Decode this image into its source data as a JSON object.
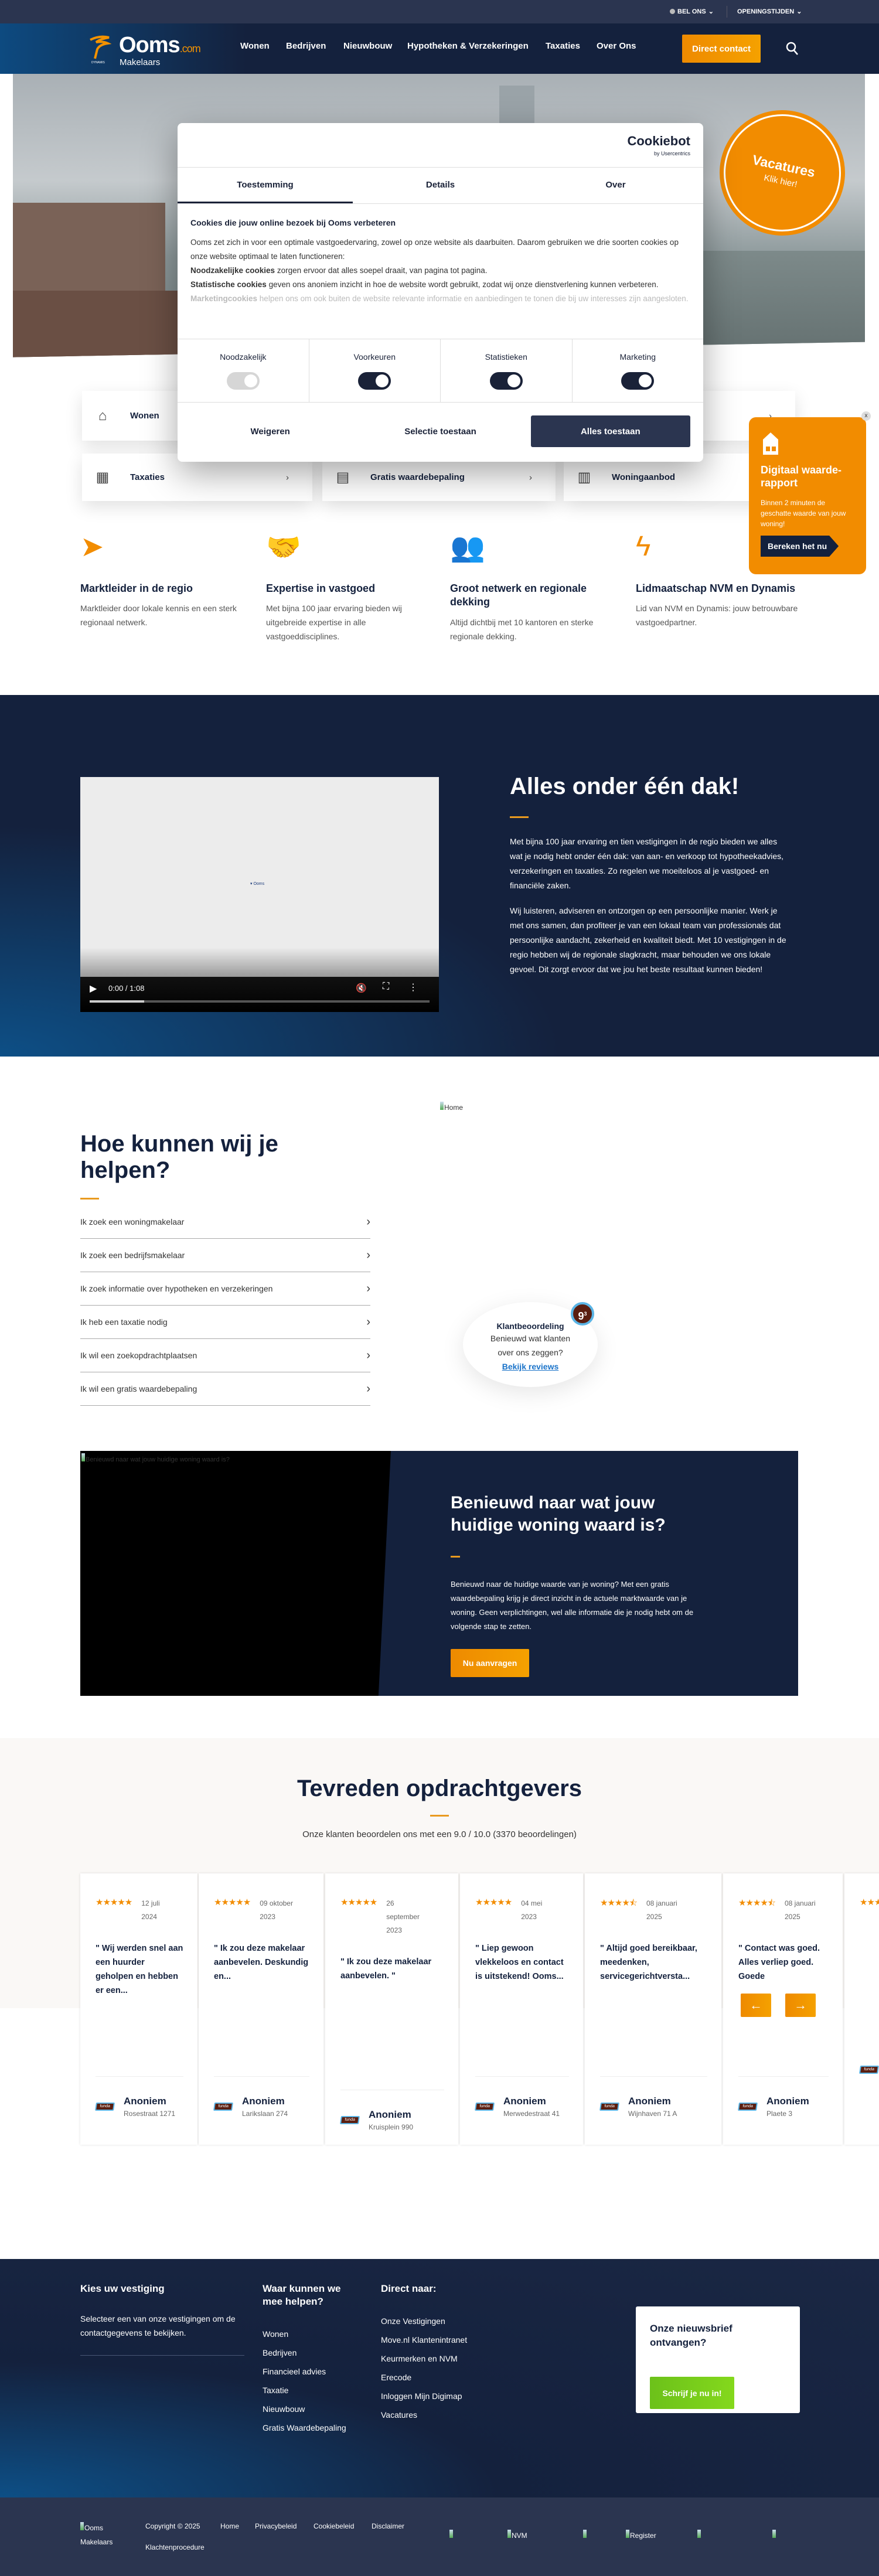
{
  "colors": {
    "accent": "#f28c00",
    "navy": "#14213d",
    "topbar": "#2b3550",
    "newsletter_button": "#6cc11a"
  },
  "topbar": {
    "call": "BEL ONS",
    "hours": "OPENINGSTIJDEN"
  },
  "header": {
    "logo_name": "Ooms",
    "logo_tld": ".com",
    "logo_sub": "Makelaars",
    "logo_group": "DYNAMIS",
    "nav": [
      "Wonen",
      "Bedrijven",
      "Nieuwbouw",
      "Hypotheken & Verzekeringen",
      "Taxaties",
      "Over Ons"
    ],
    "cta": "Direct contact",
    "search_icon": "search-icon"
  },
  "vacatures": {
    "title": "Vacatures",
    "sub": "Klik hier!"
  },
  "quicklinks": [
    {
      "label": "Wonen",
      "icon": "house-icon"
    },
    {
      "label": "Taxaties",
      "icon": "floorplan-icon"
    },
    {
      "label": "Gratis waardebepaling",
      "icon": "calculator-icon"
    },
    {
      "label": "Woningaanbod",
      "icon": "building-icon"
    }
  ],
  "digital_report": {
    "title": "Digitaal waarde-rapport",
    "text": "Binnen 2 minuten de geschatte waarde van jouw woning!",
    "button": "Bereken het nu",
    "close": "x"
  },
  "cookie": {
    "brand": "Cookiebot",
    "brand_sub": "by Usercentrics",
    "tabs": [
      "Toestemming",
      "Details",
      "Over"
    ],
    "heading": "Cookies die jouw online bezoek bij Ooms verbeteren",
    "intro": "Ooms zet zich in voor een optimale vastgoedervaring, zowel op onze website als daarbuiten. Daarom gebruiken we drie soorten cookies op onze website optimaal te laten functioneren:",
    "items": [
      {
        "term": "Noodzakelijke cookies",
        "text": " zorgen ervoor dat alles soepel draait, van pagina tot pagina."
      },
      {
        "term": "Statistische cookies",
        "text": " geven ons anoniem inzicht in hoe de website wordt gebruikt, zodat wij onze dienstverlening kunnen verbeteren."
      },
      {
        "term": "Marketingcookies",
        "text": " helpen ons om ook buiten de website relevante informatie en aanbiedingen te tonen die bij uw interesses zijn aangesloten."
      }
    ],
    "toggles": [
      {
        "label": "Noodzakelijk",
        "on": true,
        "disabled": true
      },
      {
        "label": "Voorkeuren",
        "on": true,
        "disabled": false
      },
      {
        "label": "Statistieken",
        "on": true,
        "disabled": false
      },
      {
        "label": "Marketing",
        "on": true,
        "disabled": false
      }
    ],
    "buttons": {
      "deny": "Weigeren",
      "selection": "Selectie toestaan",
      "all": "Alles toestaan"
    }
  },
  "features": [
    {
      "title": "Marktleider in de regio",
      "text": "Marktleider door lokale kennis en een sterk regionaal netwerk.",
      "icon": "location-arrow-icon"
    },
    {
      "title": "Expertise in vastgoed",
      "text": "Met bijna 100 jaar ervaring bieden wij uitgebreide expertise in alle vastgoeddisciplines.",
      "icon": "handshake-icon"
    },
    {
      "title": "Groot netwerk en regionale dekking",
      "text": "Altijd dichtbij met 10 kantoren en sterke regionale dekking.",
      "icon": "people-icon"
    },
    {
      "title": "Lidmaatschap NVM en Dynamis",
      "text": "Lid van NVM en Dynamis: jouw betrouwbare vastgoedpartner.",
      "icon": "dynamis-icon"
    }
  ],
  "video": {
    "time": "0:00 / 1:08",
    "progress": 0.16,
    "muted": true
  },
  "about": {
    "title": "Alles onder één dak!",
    "paragraphs": [
      "Met bijna 100 jaar ervaring en tien vestigingen in de regio bieden we alles wat je nodig hebt onder één dak: van aan- en verkoop tot hypotheekadvies, verzekeringen en taxaties. Zo regelen we moeiteloos al je vastgoed- en financiële zaken.",
      "Wij luisteren, adviseren en ontzorgen op een persoonlijke manier. Werk je met ons samen, dan profiteer je van een lokaal team van professionals dat persoonlijke aandacht, zekerheid en kwaliteit biedt. Met 10 vestigingen in de regio hebben wij de regionale slagkracht, maar behouden we ons lokale gevoel. Dit zorgt ervoor dat we jou het beste resultaat kunnen bieden!"
    ]
  },
  "home_image_alt": "Home",
  "help": {
    "title": "Hoe kunnen wij je helpen?",
    "items": [
      "Ik zoek een woningmakelaar",
      "Ik zoek een bedrijfsmakelaar",
      "Ik zoek informatie over hypotheken en verzekeringen",
      "Ik heb een taxatie nodig",
      "Ik wil een zoekopdrachtplaatsen",
      "Ik wil een gratis waardebepaling"
    ]
  },
  "rating_widget": {
    "score": "9",
    "score_sup": "3",
    "title": "Klantbeoordeling",
    "text": "Benieuwd wat klanten over ons zeggen?",
    "link": "Bekijk reviews"
  },
  "valuation": {
    "image_alt": "Benieuwd naar wat jouw huidige woning waard is?",
    "title": "Benieuwd naar wat jouw huidige woning waard is?",
    "text": "Benieuwd naar de huidige waarde van je woning? Met een gratis waardebepaling krijg je direct inzicht in de actuele marktwaarde van je woning. Geen verplichtingen, wel alle informatie die je nodig hebt om de volgende stap te zetten.",
    "button": "Nu aanvragen"
  },
  "reviews": {
    "title": "Tevreden opdrachtgevers",
    "subtitle": "Onze klanten beoordelen ons met een 9.0 / 10.0 (3370 beoordelingen)",
    "source": "funda",
    "items": [
      {
        "stars": 5,
        "date": "12 juli 2024",
        "quote": "\" Wij werden snel aan een huurder geholpen en hebben er een...",
        "name": "Anoniem",
        "address": "Rosestraat 1271"
      },
      {
        "stars": 5,
        "date": "09 oktober 2023",
        "quote": "\" Ik zou deze makelaar aanbevelen. Deskundig en...",
        "name": "Anoniem",
        "address": "Larikslaan 274"
      },
      {
        "stars": 5,
        "date": "26 september 2023",
        "quote": "\" Ik zou deze makelaar aanbevelen. \"",
        "name": "Anoniem",
        "address": "Kruisplein 990"
      },
      {
        "stars": 5,
        "date": "04 mei 2023",
        "quote": "\" Liep gewoon vlekkeloos en contact is uitstekend! Ooms...",
        "name": "Anoniem",
        "address": "Merwedestraat 41"
      },
      {
        "stars": 4.5,
        "date": "08 januari 2025",
        "quote": "\" Altijd goed bereikbaar, meedenken, servicegerichtversta...",
        "name": "Anoniem",
        "address": "Wijnhaven 71 A"
      },
      {
        "stars": 4.5,
        "date": "08 januari 2025",
        "quote": "\" Contact was goed. Alles verliep goed. Goede",
        "name": "Anoniem",
        "address": "Plaete 3"
      }
    ],
    "prev_icon": "arrow-left-icon",
    "next_icon": "arrow-right-icon"
  },
  "footer": {
    "col1": {
      "title": "Kies uw vestiging",
      "text": "Selecteer een van onze vestigingen om de contactgegevens te bekijken."
    },
    "col2": {
      "title": "Waar kunnen we mee helpen?",
      "links": [
        "Wonen",
        "Bedrijven",
        "Financieel advies",
        "Taxatie",
        "Nieuwbouw",
        "Gratis Waardebepaling"
      ]
    },
    "col3": {
      "title": "Direct naar:",
      "links": [
        "Onze Vestigingen",
        "Move.nl Klantenintranet",
        "Keurmerken en NVM Erecode",
        "Inloggen Mijn Digimap",
        "Vacatures"
      ]
    },
    "newsletter": {
      "title": "Onze nieuwsbrief ontvangen?",
      "button": "Schrijf je nu in!"
    },
    "bottom": {
      "logo_alt": "Ooms Makelaars",
      "copyright": "Copyright © 2025",
      "links": [
        "Home",
        "Privacybeleid",
        "Cookiebeleid",
        "Disclaimer",
        "Klachtenprocedure"
      ],
      "badges": [
        "",
        "NVM",
        "",
        "Register",
        "",
        ""
      ]
    }
  }
}
